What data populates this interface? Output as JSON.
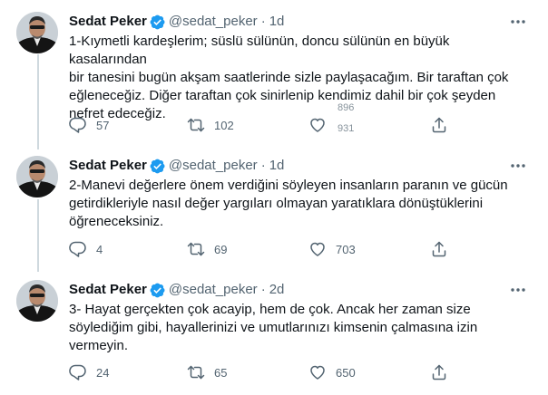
{
  "author": {
    "name": "Sedat Peker",
    "handle": "@sedat_peker"
  },
  "colors": {
    "text": "#0f1419",
    "secondary": "#536471",
    "verified": "#1d9bf0",
    "thread_line": "#cfd9de"
  },
  "icons": {
    "reply": "reply-icon",
    "retweet": "retweet-icon",
    "like": "heart-icon",
    "share": "share-icon",
    "more": "more-icon",
    "verified": "verified-badge-icon"
  },
  "tweets": [
    {
      "time": "1d",
      "text": "1-Kıymetli kardeşlerim; süslü sülünün, doncu sülünün en büyük kasalarından\nbir tanesini bugün akşam saatlerinde sizle paylaşacağım. Bir taraftan çok\neğleneceğiz. Diğer taraftan çok sinirlenip kendimiz dahil bir çok şeyden\nnefret edeceğiz.",
      "replies": "57",
      "retweets": "102",
      "likes": "",
      "likes_ghost_top": "896",
      "likes_ghost_bottom": "931"
    },
    {
      "time": "1d",
      "text": "2-Manevi değerlere önem verdiğini söyleyen insanların paranın ve gücün\ngetirdikleriyle nasıl değer yargıları olmayan yaratıklara dönüştüklerini\nöğreneceksiniz.",
      "replies": "4",
      "retweets": "69",
      "likes": "703"
    },
    {
      "time": "2d",
      "text": "3- Hayat gerçekten çok acayip, hem de çok. Ancak her zaman size\nsöylediğim gibi, hayallerinizi ve umutlarınızı kimsenin çalmasına izin\nvermeyin.",
      "replies": "24",
      "retweets": "65",
      "likes": "650"
    }
  ]
}
